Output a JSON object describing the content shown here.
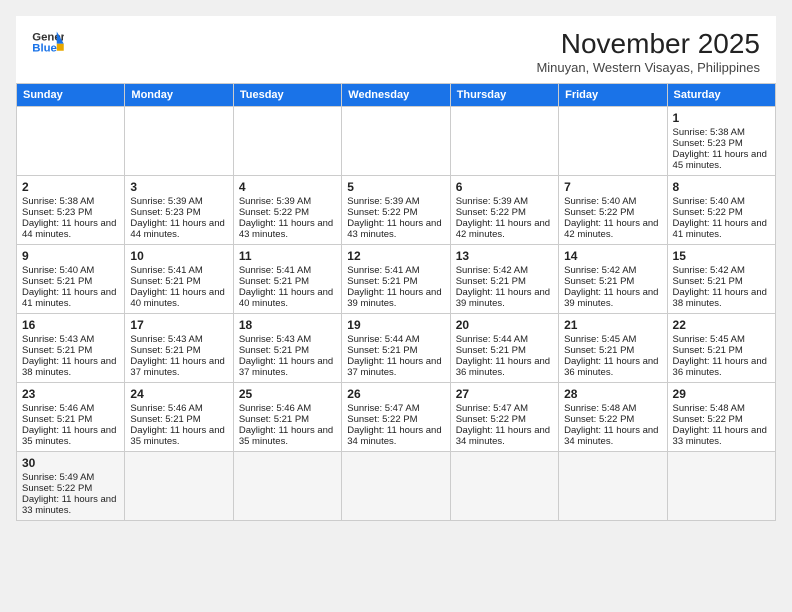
{
  "header": {
    "logo_line1": "General",
    "logo_line2": "Blue",
    "month_title": "November 2025",
    "location": "Minuyan, Western Visayas, Philippines"
  },
  "days_of_week": [
    "Sunday",
    "Monday",
    "Tuesday",
    "Wednesday",
    "Thursday",
    "Friday",
    "Saturday"
  ],
  "weeks": [
    [
      {
        "day": "",
        "sunrise": "",
        "sunset": "",
        "daylight": ""
      },
      {
        "day": "",
        "sunrise": "",
        "sunset": "",
        "daylight": ""
      },
      {
        "day": "",
        "sunrise": "",
        "sunset": "",
        "daylight": ""
      },
      {
        "day": "",
        "sunrise": "",
        "sunset": "",
        "daylight": ""
      },
      {
        "day": "",
        "sunrise": "",
        "sunset": "",
        "daylight": ""
      },
      {
        "day": "",
        "sunrise": "",
        "sunset": "",
        "daylight": ""
      },
      {
        "day": "1",
        "sunrise": "Sunrise: 5:38 AM",
        "sunset": "Sunset: 5:23 PM",
        "daylight": "Daylight: 11 hours and 45 minutes."
      }
    ],
    [
      {
        "day": "2",
        "sunrise": "Sunrise: 5:38 AM",
        "sunset": "Sunset: 5:23 PM",
        "daylight": "Daylight: 11 hours and 44 minutes."
      },
      {
        "day": "3",
        "sunrise": "Sunrise: 5:39 AM",
        "sunset": "Sunset: 5:23 PM",
        "daylight": "Daylight: 11 hours and 44 minutes."
      },
      {
        "day": "4",
        "sunrise": "Sunrise: 5:39 AM",
        "sunset": "Sunset: 5:22 PM",
        "daylight": "Daylight: 11 hours and 43 minutes."
      },
      {
        "day": "5",
        "sunrise": "Sunrise: 5:39 AM",
        "sunset": "Sunset: 5:22 PM",
        "daylight": "Daylight: 11 hours and 43 minutes."
      },
      {
        "day": "6",
        "sunrise": "Sunrise: 5:39 AM",
        "sunset": "Sunset: 5:22 PM",
        "daylight": "Daylight: 11 hours and 42 minutes."
      },
      {
        "day": "7",
        "sunrise": "Sunrise: 5:40 AM",
        "sunset": "Sunset: 5:22 PM",
        "daylight": "Daylight: 11 hours and 42 minutes."
      },
      {
        "day": "8",
        "sunrise": "Sunrise: 5:40 AM",
        "sunset": "Sunset: 5:22 PM",
        "daylight": "Daylight: 11 hours and 41 minutes."
      }
    ],
    [
      {
        "day": "9",
        "sunrise": "Sunrise: 5:40 AM",
        "sunset": "Sunset: 5:21 PM",
        "daylight": "Daylight: 11 hours and 41 minutes."
      },
      {
        "day": "10",
        "sunrise": "Sunrise: 5:41 AM",
        "sunset": "Sunset: 5:21 PM",
        "daylight": "Daylight: 11 hours and 40 minutes."
      },
      {
        "day": "11",
        "sunrise": "Sunrise: 5:41 AM",
        "sunset": "Sunset: 5:21 PM",
        "daylight": "Daylight: 11 hours and 40 minutes."
      },
      {
        "day": "12",
        "sunrise": "Sunrise: 5:41 AM",
        "sunset": "Sunset: 5:21 PM",
        "daylight": "Daylight: 11 hours and 39 minutes."
      },
      {
        "day": "13",
        "sunrise": "Sunrise: 5:42 AM",
        "sunset": "Sunset: 5:21 PM",
        "daylight": "Daylight: 11 hours and 39 minutes."
      },
      {
        "day": "14",
        "sunrise": "Sunrise: 5:42 AM",
        "sunset": "Sunset: 5:21 PM",
        "daylight": "Daylight: 11 hours and 39 minutes."
      },
      {
        "day": "15",
        "sunrise": "Sunrise: 5:42 AM",
        "sunset": "Sunset: 5:21 PM",
        "daylight": "Daylight: 11 hours and 38 minutes."
      }
    ],
    [
      {
        "day": "16",
        "sunrise": "Sunrise: 5:43 AM",
        "sunset": "Sunset: 5:21 PM",
        "daylight": "Daylight: 11 hours and 38 minutes."
      },
      {
        "day": "17",
        "sunrise": "Sunrise: 5:43 AM",
        "sunset": "Sunset: 5:21 PM",
        "daylight": "Daylight: 11 hours and 37 minutes."
      },
      {
        "day": "18",
        "sunrise": "Sunrise: 5:43 AM",
        "sunset": "Sunset: 5:21 PM",
        "daylight": "Daylight: 11 hours and 37 minutes."
      },
      {
        "day": "19",
        "sunrise": "Sunrise: 5:44 AM",
        "sunset": "Sunset: 5:21 PM",
        "daylight": "Daylight: 11 hours and 37 minutes."
      },
      {
        "day": "20",
        "sunrise": "Sunrise: 5:44 AM",
        "sunset": "Sunset: 5:21 PM",
        "daylight": "Daylight: 11 hours and 36 minutes."
      },
      {
        "day": "21",
        "sunrise": "Sunrise: 5:45 AM",
        "sunset": "Sunset: 5:21 PM",
        "daylight": "Daylight: 11 hours and 36 minutes."
      },
      {
        "day": "22",
        "sunrise": "Sunrise: 5:45 AM",
        "sunset": "Sunset: 5:21 PM",
        "daylight": "Daylight: 11 hours and 36 minutes."
      }
    ],
    [
      {
        "day": "23",
        "sunrise": "Sunrise: 5:46 AM",
        "sunset": "Sunset: 5:21 PM",
        "daylight": "Daylight: 11 hours and 35 minutes."
      },
      {
        "day": "24",
        "sunrise": "Sunrise: 5:46 AM",
        "sunset": "Sunset: 5:21 PM",
        "daylight": "Daylight: 11 hours and 35 minutes."
      },
      {
        "day": "25",
        "sunrise": "Sunrise: 5:46 AM",
        "sunset": "Sunset: 5:21 PM",
        "daylight": "Daylight: 11 hours and 35 minutes."
      },
      {
        "day": "26",
        "sunrise": "Sunrise: 5:47 AM",
        "sunset": "Sunset: 5:22 PM",
        "daylight": "Daylight: 11 hours and 34 minutes."
      },
      {
        "day": "27",
        "sunrise": "Sunrise: 5:47 AM",
        "sunset": "Sunset: 5:22 PM",
        "daylight": "Daylight: 11 hours and 34 minutes."
      },
      {
        "day": "28",
        "sunrise": "Sunrise: 5:48 AM",
        "sunset": "Sunset: 5:22 PM",
        "daylight": "Daylight: 11 hours and 34 minutes."
      },
      {
        "day": "29",
        "sunrise": "Sunrise: 5:48 AM",
        "sunset": "Sunset: 5:22 PM",
        "daylight": "Daylight: 11 hours and 33 minutes."
      }
    ],
    [
      {
        "day": "30",
        "sunrise": "Sunrise: 5:49 AM",
        "sunset": "Sunset: 5:22 PM",
        "daylight": "Daylight: 11 hours and 33 minutes."
      },
      {
        "day": "",
        "sunrise": "",
        "sunset": "",
        "daylight": ""
      },
      {
        "day": "",
        "sunrise": "",
        "sunset": "",
        "daylight": ""
      },
      {
        "day": "",
        "sunrise": "",
        "sunset": "",
        "daylight": ""
      },
      {
        "day": "",
        "sunrise": "",
        "sunset": "",
        "daylight": ""
      },
      {
        "day": "",
        "sunrise": "",
        "sunset": "",
        "daylight": ""
      },
      {
        "day": "",
        "sunrise": "",
        "sunset": "",
        "daylight": ""
      }
    ]
  ]
}
